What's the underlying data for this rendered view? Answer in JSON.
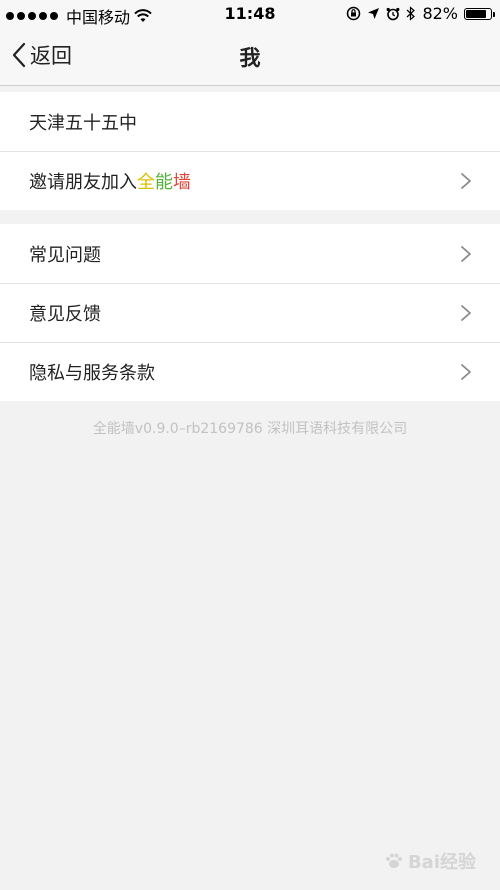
{
  "status_bar": {
    "carrier": "中国移动",
    "time": "11:48",
    "battery_percent": "82%",
    "battery_level": 0.82,
    "signal_bars": 5
  },
  "nav": {
    "back_label": "返回",
    "title": "我"
  },
  "profile": {
    "school": "天津五十五中",
    "invite_prefix": "邀请朋友加入",
    "app_name_chars": [
      "全",
      "能",
      "墙"
    ]
  },
  "menu": {
    "faq": "常见问题",
    "feedback": "意见反馈",
    "privacy": "隐私与服务条款"
  },
  "footer": {
    "version_text": "全能墙v0.9.0–rb2169786 深圳耳语科技有限公司"
  },
  "watermark": {
    "text": "Bai经验"
  },
  "colors": {
    "app_name_char_1": "#d9c200",
    "app_name_char_2": "#55b13a",
    "app_name_char_3": "#e0473b",
    "background": "#f2f2f2"
  },
  "icons": {
    "wifi": "wifi-icon",
    "lock_rotation": "orientation-lock-icon",
    "location": "location-arrow-icon",
    "alarm": "alarm-icon",
    "bluetooth": "bluetooth-icon",
    "back": "chevron-left-icon",
    "disclosure": "chevron-right-icon"
  }
}
